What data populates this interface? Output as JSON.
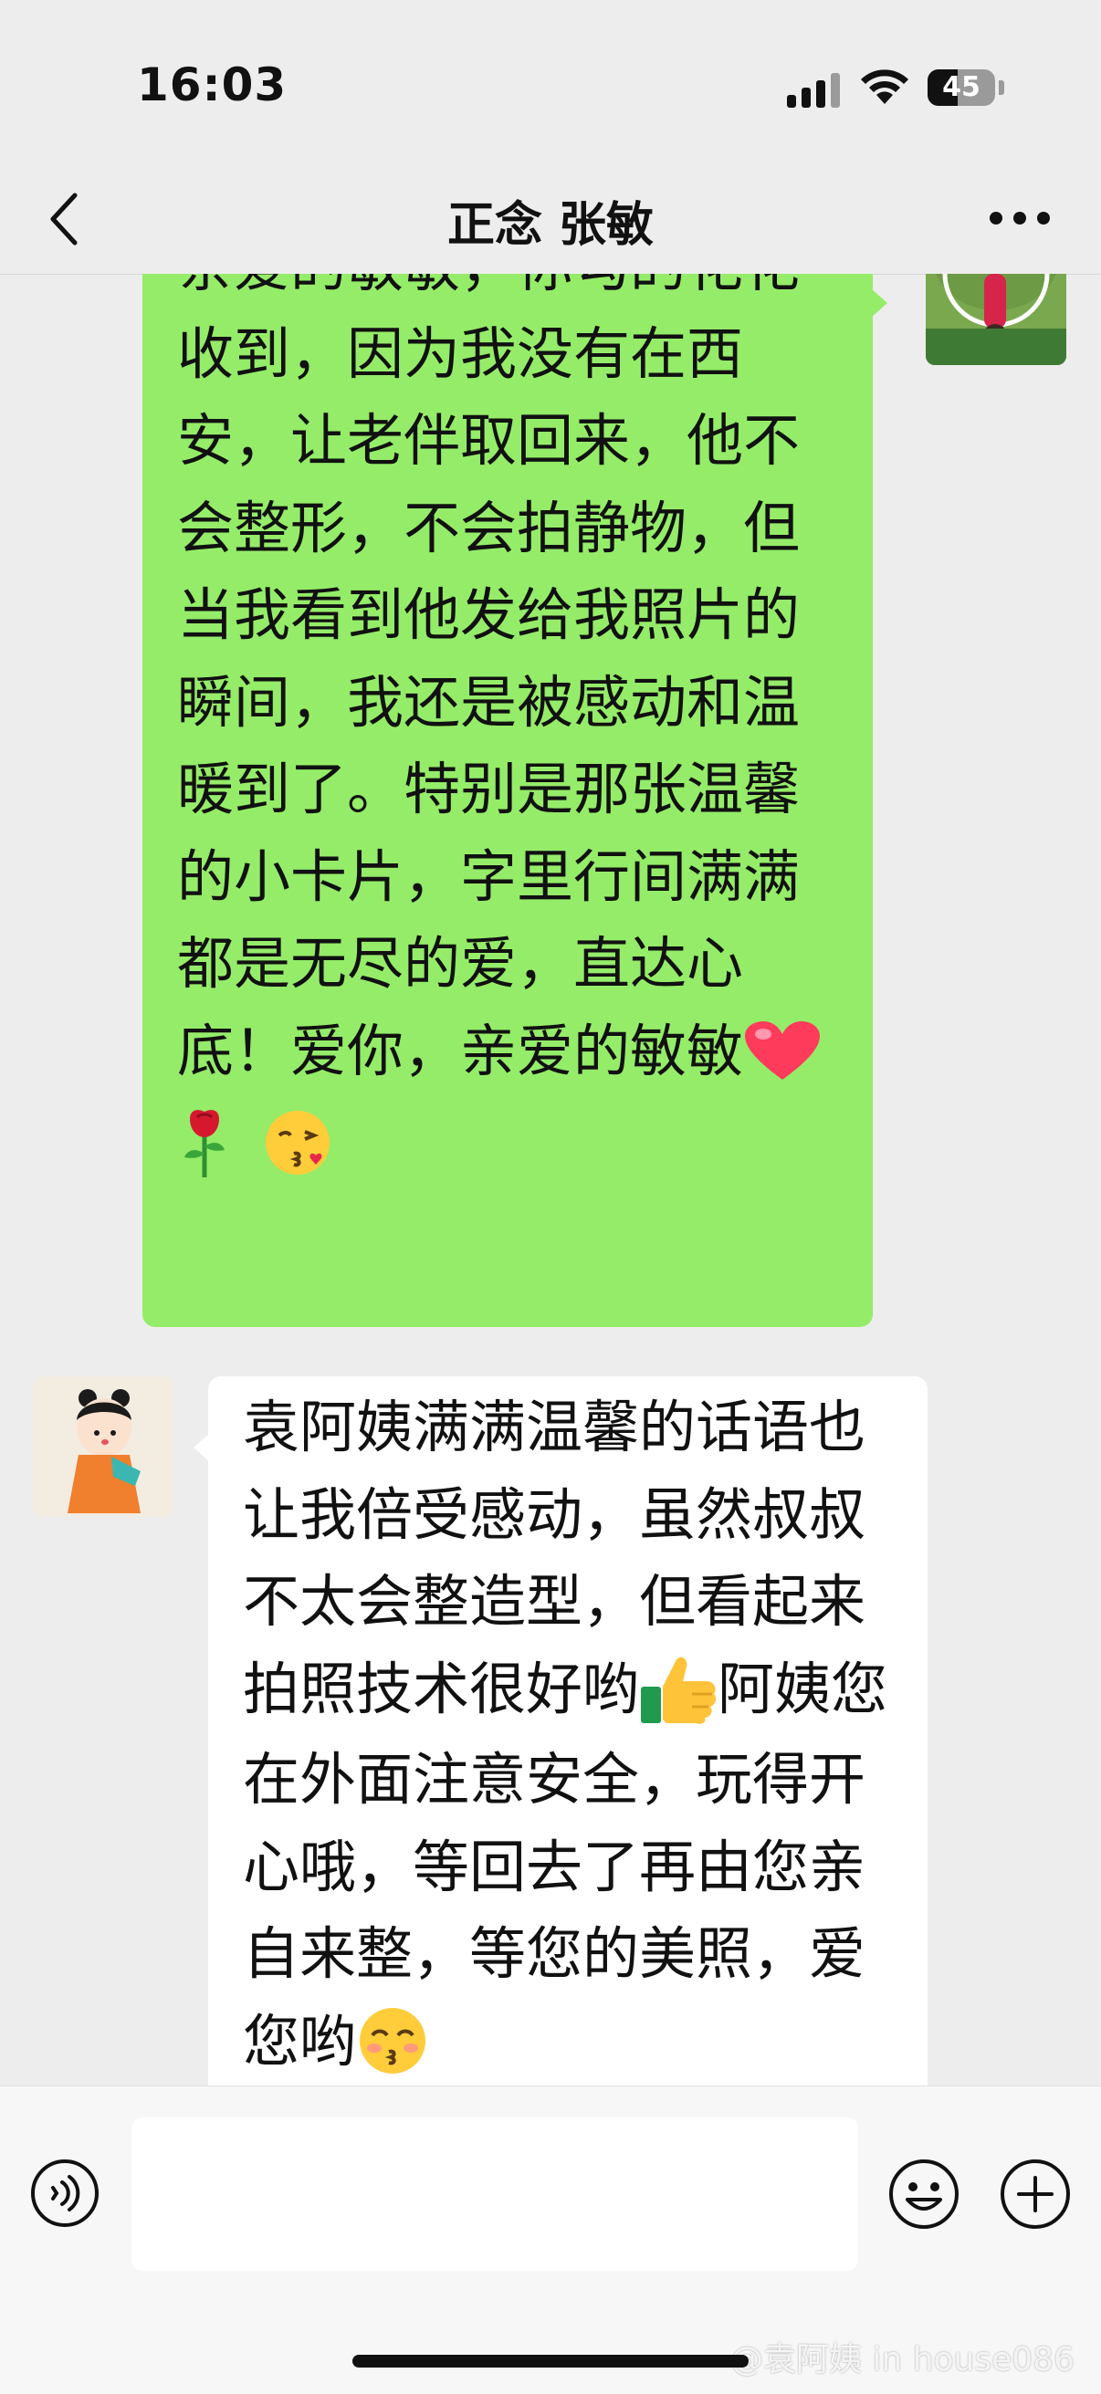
{
  "status_bar": {
    "time": "16:03",
    "battery_percent": "45",
    "battery_level": 0.45
  },
  "header": {
    "title": "正念 张敏",
    "back_icon": "chevron-left-icon",
    "more_icon": "ellipsis-icon"
  },
  "messages": [
    {
      "direction": "outgoing",
      "text": "亲爱的敏敏，你勾的花花收到，因为我没有在西安，让老伴取回来，他不会整形，不会拍静物，但当我看到他发给我照片的瞬间，我还是被感动和温暖到了。特别是那张温馨的小卡片，字里行间满满都是无尽的爱，直达心底！爱你，亲爱的敏敏",
      "emojis": [
        "❤️",
        "🌹",
        "😘"
      ]
    },
    {
      "direction": "incoming",
      "text_before": "袁阿姨满满温馨的话语也让我倍受感动，虽然叔叔不太会整造型，但看起来拍照技术很好哟",
      "emoji_mid": "👍",
      "text_after": "阿姨您在外面注意安全，玩得开心哦，等回去了再由您亲自来整，等您的美照，爱您哟",
      "emoji_end": "😚"
    }
  ],
  "input_bar": {
    "voice_icon": "voice-icon",
    "input_value": "",
    "emoji_icon": "smiley-icon",
    "plus_icon": "plus-circle-icon"
  },
  "watermark": "@袁阿姨 in house086",
  "colors": {
    "background": "#ededed",
    "outgoing_bubble": "#95ec69",
    "incoming_bubble": "#ffffff"
  }
}
